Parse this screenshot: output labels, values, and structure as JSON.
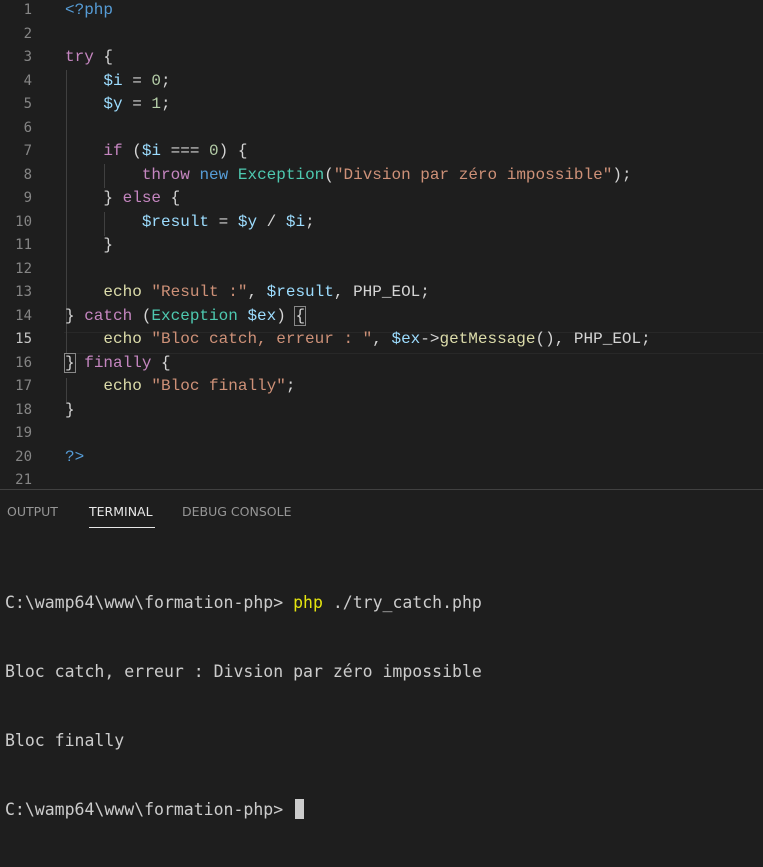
{
  "editor": {
    "lines": [
      {
        "num": "1",
        "tokens": [
          {
            "t": "<?php",
            "c": "tag"
          }
        ]
      },
      {
        "num": "2",
        "tokens": []
      },
      {
        "num": "3",
        "tokens": [
          {
            "t": "try",
            "c": "kw"
          },
          {
            "t": " {",
            "c": "plain"
          }
        ]
      },
      {
        "num": "4",
        "tokens": [
          {
            "t": "    ",
            "c": "plain"
          },
          {
            "t": "$i",
            "c": "var"
          },
          {
            "t": " = ",
            "c": "plain"
          },
          {
            "t": "0",
            "c": "num"
          },
          {
            "t": ";",
            "c": "plain"
          }
        ]
      },
      {
        "num": "5",
        "tokens": [
          {
            "t": "    ",
            "c": "plain"
          },
          {
            "t": "$y",
            "c": "var"
          },
          {
            "t": " = ",
            "c": "plain"
          },
          {
            "t": "1",
            "c": "num"
          },
          {
            "t": ";",
            "c": "plain"
          }
        ]
      },
      {
        "num": "6",
        "tokens": []
      },
      {
        "num": "7",
        "tokens": [
          {
            "t": "    ",
            "c": "plain"
          },
          {
            "t": "if",
            "c": "kw"
          },
          {
            "t": " (",
            "c": "plain"
          },
          {
            "t": "$i",
            "c": "var"
          },
          {
            "t": " === ",
            "c": "plain"
          },
          {
            "t": "0",
            "c": "num"
          },
          {
            "t": ") {",
            "c": "plain"
          }
        ]
      },
      {
        "num": "8",
        "tokens": [
          {
            "t": "        ",
            "c": "plain"
          },
          {
            "t": "throw",
            "c": "kw"
          },
          {
            "t": " ",
            "c": "plain"
          },
          {
            "t": "new",
            "c": "kb"
          },
          {
            "t": " ",
            "c": "plain"
          },
          {
            "t": "Exception",
            "c": "cls"
          },
          {
            "t": "(",
            "c": "plain"
          },
          {
            "t": "\"Divsion par zéro impossible\"",
            "c": "str"
          },
          {
            "t": ");",
            "c": "plain"
          }
        ]
      },
      {
        "num": "9",
        "tokens": [
          {
            "t": "    } ",
            "c": "plain"
          },
          {
            "t": "else",
            "c": "kw"
          },
          {
            "t": " {",
            "c": "plain"
          }
        ]
      },
      {
        "num": "10",
        "tokens": [
          {
            "t": "        ",
            "c": "plain"
          },
          {
            "t": "$result",
            "c": "var"
          },
          {
            "t": " = ",
            "c": "plain"
          },
          {
            "t": "$y",
            "c": "var"
          },
          {
            "t": " / ",
            "c": "plain"
          },
          {
            "t": "$i",
            "c": "var"
          },
          {
            "t": ";",
            "c": "plain"
          }
        ]
      },
      {
        "num": "11",
        "tokens": [
          {
            "t": "    }",
            "c": "plain"
          }
        ]
      },
      {
        "num": "12",
        "tokens": []
      },
      {
        "num": "13",
        "tokens": [
          {
            "t": "    ",
            "c": "plain"
          },
          {
            "t": "echo",
            "c": "fn"
          },
          {
            "t": " ",
            "c": "plain"
          },
          {
            "t": "\"Result :\"",
            "c": "str"
          },
          {
            "t": ", ",
            "c": "plain"
          },
          {
            "t": "$result",
            "c": "var"
          },
          {
            "t": ", PHP_EOL;",
            "c": "plain"
          }
        ]
      },
      {
        "num": "14",
        "tokens": [
          {
            "t": "} ",
            "c": "plain"
          },
          {
            "t": "catch",
            "c": "kw"
          },
          {
            "t": " (",
            "c": "plain"
          },
          {
            "t": "Exception",
            "c": "cls"
          },
          {
            "t": " ",
            "c": "plain"
          },
          {
            "t": "$ex",
            "c": "var"
          },
          {
            "t": ") ",
            "c": "plain"
          },
          {
            "t": "{",
            "c": "plain",
            "box": true
          }
        ]
      },
      {
        "num": "15",
        "tokens": [
          {
            "t": "    ",
            "c": "plain"
          },
          {
            "t": "echo",
            "c": "fn"
          },
          {
            "t": " ",
            "c": "plain"
          },
          {
            "t": "\"Bloc catch, erreur : \"",
            "c": "str"
          },
          {
            "t": ", ",
            "c": "plain"
          },
          {
            "t": "$ex",
            "c": "var"
          },
          {
            "t": "->",
            "c": "plain"
          },
          {
            "t": "getMessage",
            "c": "fn"
          },
          {
            "t": "(), PHP_EOL;",
            "c": "plain"
          }
        ],
        "current": true
      },
      {
        "num": "16",
        "tokens": [
          {
            "t": "}",
            "c": "plain",
            "box": true
          },
          {
            "t": " ",
            "c": "plain"
          },
          {
            "t": "finally",
            "c": "kw"
          },
          {
            "t": " {",
            "c": "plain"
          }
        ]
      },
      {
        "num": "17",
        "tokens": [
          {
            "t": "    ",
            "c": "plain"
          },
          {
            "t": "echo",
            "c": "fn"
          },
          {
            "t": " ",
            "c": "plain"
          },
          {
            "t": "\"Bloc finally\"",
            "c": "str"
          },
          {
            "t": ";",
            "c": "plain"
          }
        ]
      },
      {
        "num": "18",
        "tokens": [
          {
            "t": "}",
            "c": "plain"
          }
        ]
      },
      {
        "num": "19",
        "tokens": []
      },
      {
        "num": "20",
        "tokens": [
          {
            "t": "?>",
            "c": "tag"
          }
        ]
      },
      {
        "num": "21",
        "tokens": []
      }
    ]
  },
  "panel": {
    "tabs": [
      {
        "label": "OUTPUT",
        "active": false
      },
      {
        "label": "TERMINAL",
        "active": true
      },
      {
        "label": "DEBUG CONSOLE",
        "active": false
      }
    ],
    "terminal": {
      "prompt": "C:\\wamp64\\www\\formation-php>",
      "command_exe": "php",
      "command_args": " ./try_catch.php",
      "output": [
        "Bloc catch, erreur : Divsion par zéro impossible",
        "Bloc finally"
      ],
      "prompt2": "C:\\wamp64\\www\\formation-php>"
    }
  }
}
